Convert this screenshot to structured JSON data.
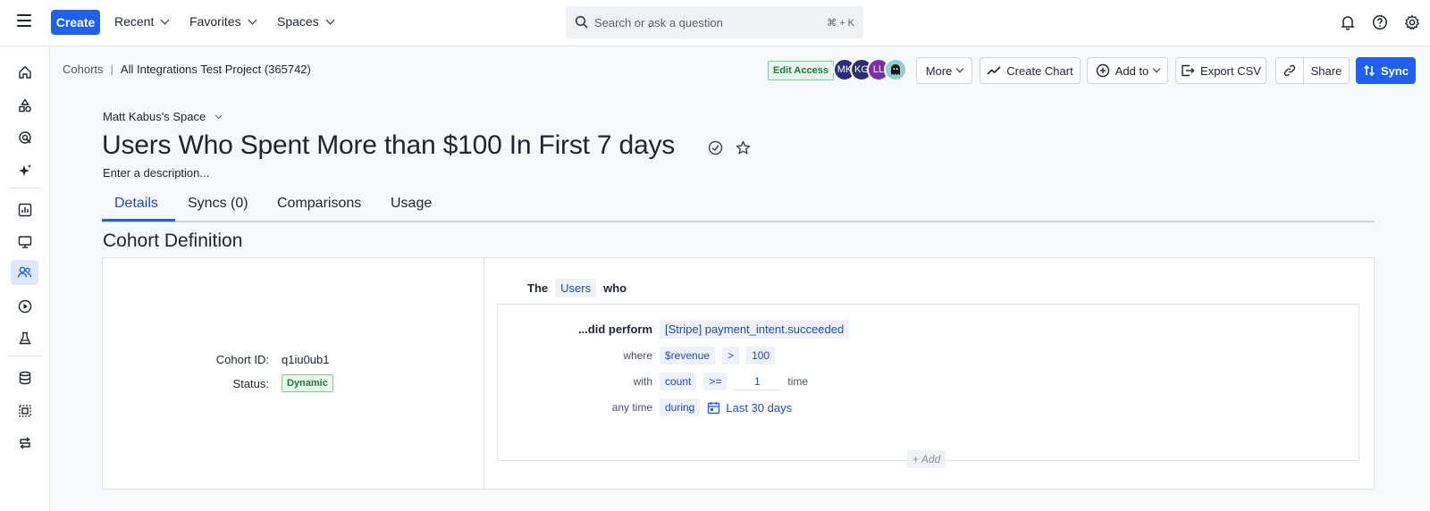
{
  "topbar": {
    "create_label": "Create",
    "nav": [
      "Recent",
      "Favorites",
      "Spaces"
    ],
    "search_placeholder": "Search or ask a question",
    "search_shortcut": "⌘ + K"
  },
  "breadcrumb": {
    "root": "Cohorts",
    "separator": "|",
    "project": "All Integrations Test Project (365742)"
  },
  "toolbar": {
    "edit_access": "Edit Access",
    "avatars": [
      {
        "initials": "MK",
        "color": "#2b2d7c"
      },
      {
        "initials": "KG",
        "color": "#2a2f6e"
      },
      {
        "initials": "LL",
        "color": "#7b2fa8"
      }
    ],
    "more": "More",
    "create_chart": "Create Chart",
    "add_to": "Add to",
    "export_csv": "Export CSV",
    "share": "Share",
    "sync": "Sync"
  },
  "page": {
    "space": "Matt Kabus's Space",
    "title": "Users Who Spent More than $100 In First 7 days",
    "description": "Enter a description..."
  },
  "tabs": [
    "Details",
    "Syncs (0)",
    "Comparisons",
    "Usage"
  ],
  "section_title": "Cohort Definition",
  "cohort": {
    "id_label": "Cohort ID:",
    "id_value": "q1iu0ub1",
    "status_label": "Status:",
    "status_value": "Dynamic"
  },
  "definition": {
    "the": "The",
    "entity": "Users",
    "who": "who",
    "perform_label": "...did perform",
    "event": "[Stripe] payment_intent.succeeded",
    "where_label": "where",
    "property": "$revenue",
    "operator": ">",
    "value": "100",
    "with_label": "with",
    "count_metric": "count",
    "count_operator": ">=",
    "count_value": "1",
    "count_unit": "time",
    "anytime_label": "any time",
    "during": "during",
    "range": "Last 30 days",
    "add": "+ Add"
  },
  "colors": {
    "accent": "#1e61f0",
    "status_green": "#1c7a3c"
  }
}
